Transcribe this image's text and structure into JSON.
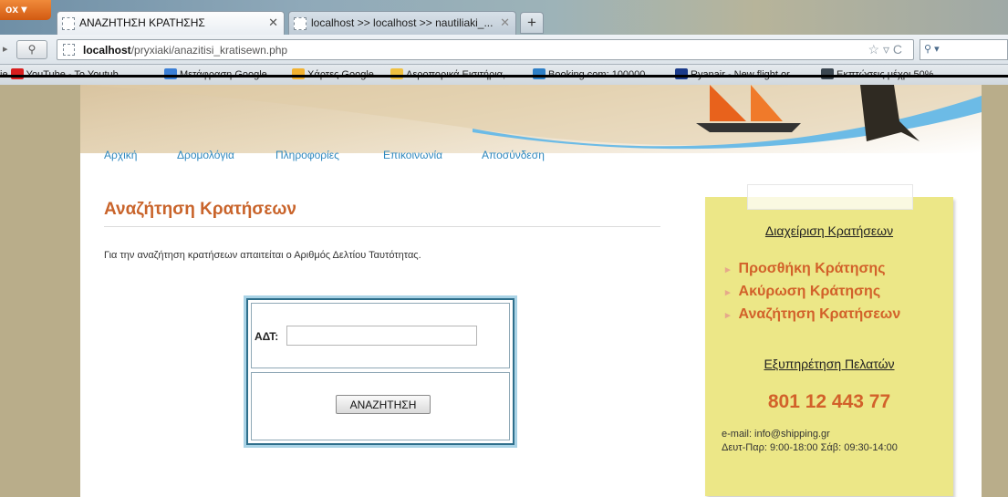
{
  "browser": {
    "menu_button": "ox ▾",
    "tabs": [
      {
        "label": "ΑΝΑΖΗΤΗΣΗ ΚΡΑΤΗΣΗΣ",
        "close": "✕"
      },
      {
        "label": "localhost >> localhost >> nautiliaki_...",
        "close": "✕"
      }
    ],
    "new_tab": "+",
    "url_host": "localhost",
    "url_path": "/pryxiaki/anazitisi_kratisewn.php",
    "url_icons": "☆ ▿ C",
    "search_text": "▾",
    "bookmarks": [
      "YouTube - To Youtub...",
      "Μετάφραση Google",
      "Χάρτες Google",
      "Αεροπορικά Εισιτήρια,...",
      "Booking.com: 100000...",
      "Ryanair - New flight or...",
      "Εκπτώσεις μέχρι 50%..."
    ]
  },
  "nav": {
    "home": "Αρχική",
    "routes": "Δρομολόγια",
    "info": "Πληροφορίες",
    "contact": "Επικοινωνία",
    "logout": "Αποσύνδεση"
  },
  "main": {
    "title": "Αναζήτηση Κρατήσεων",
    "intro": "Για την αναζήτηση κρατήσεων απαιτείται ο Αριθμός Δελτίου Ταυτότητας.",
    "form": {
      "adt_label": "ΑΔΤ:",
      "adt_value": "",
      "search_button": "ΑΝΑΖΗΤΗΣΗ"
    }
  },
  "sidebar": {
    "booking_heading": "Διαχείριση Κρατήσεων",
    "items": [
      "Προσθήκη Κράτησης",
      "Ακύρωση Κράτησης",
      "Αναζήτηση Κρατήσεων"
    ],
    "service_heading": "Εξυπηρέτηση Πελατών",
    "phone": "801 12 443 77",
    "email": "e-mail: info@shipping.gr",
    "hours": "Δευτ-Παρ: 9:00-18:00 Σάβ: 09:30-14:00"
  }
}
